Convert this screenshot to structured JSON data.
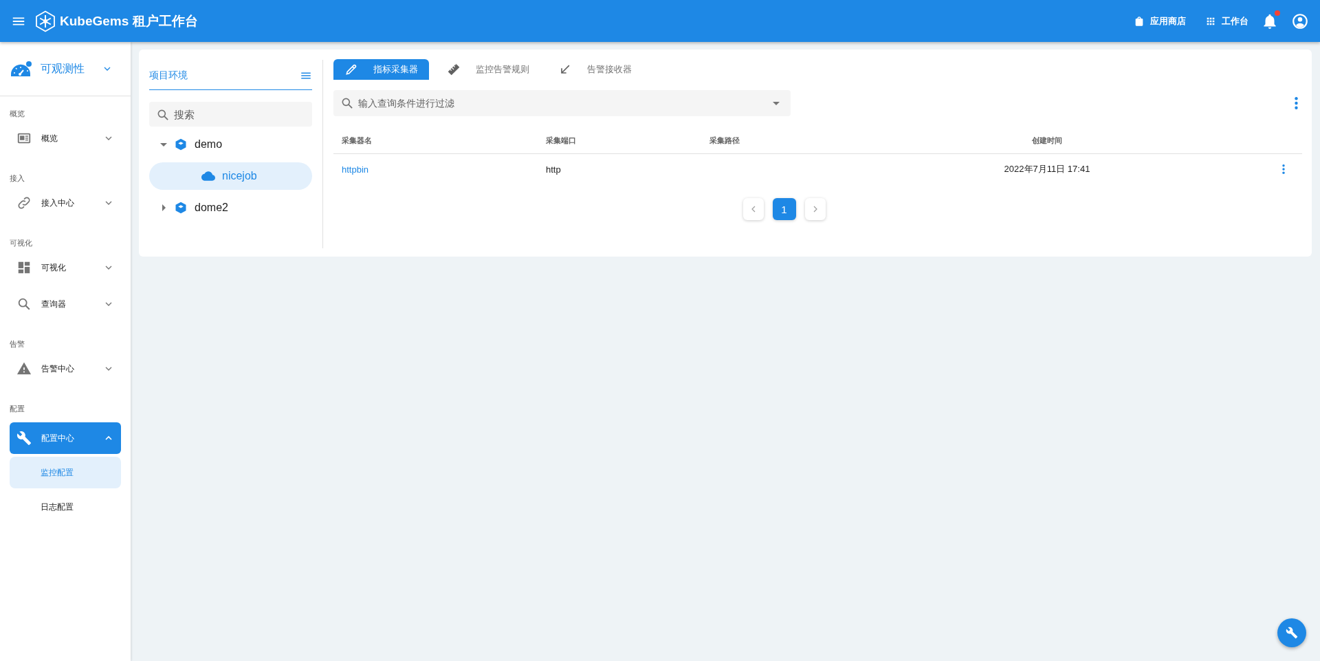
{
  "top_bar": {
    "title": "KubeGems 租户工作台",
    "links": [
      {
        "label": "应用商店",
        "kind": "store"
      },
      {
        "label": "工作台",
        "kind": "apps"
      }
    ],
    "notifications": {
      "unread": true
    }
  },
  "sidebar": {
    "header": {
      "label": "可观测性",
      "expanded": false
    },
    "sections": [
      {
        "label": "概览",
        "items": [
          {
            "label": "概览",
            "kind": "overview",
            "selected": false,
            "expanded": false
          }
        ]
      },
      {
        "label": "接入",
        "items": [
          {
            "label": "接入中心",
            "kind": "link",
            "selected": false,
            "expanded": false
          }
        ]
      },
      {
        "label": "可视化",
        "items": [
          {
            "label": "可视化",
            "kind": "dashboard",
            "selected": false,
            "expanded": false
          },
          {
            "label": "查询器",
            "kind": "search",
            "selected": false,
            "expanded": false
          }
        ]
      },
      {
        "label": "告警",
        "items": [
          {
            "label": "告警中心",
            "kind": "warning",
            "selected": false,
            "expanded": false
          }
        ]
      },
      {
        "label": "配置",
        "items": [
          {
            "label": "配置中心",
            "kind": "wrench",
            "selected": true,
            "expanded": true,
            "children": [
              {
                "label": "监控配置",
                "selected": true
              },
              {
                "label": "日志配置",
                "selected": false
              }
            ]
          }
        ]
      }
    ]
  },
  "tree_panel": {
    "title": "项目环境",
    "search": {
      "placeholder": "搜索"
    },
    "items": [
      {
        "label": "demo",
        "kind": "project",
        "expanded": true,
        "selected": false,
        "children": [
          {
            "label": "nicejob",
            "kind": "environment",
            "selected": true
          }
        ]
      },
      {
        "label": "dome2",
        "kind": "project",
        "expanded": false,
        "selected": false
      }
    ]
  },
  "tabs": [
    {
      "label": "指标采集器",
      "kind": "collector",
      "selected": true
    },
    {
      "label": "监控告警规则",
      "kind": "rule",
      "selected": false
    },
    {
      "label": "告警接收器",
      "kind": "receiver",
      "selected": false
    }
  ],
  "filter": {
    "placeholder": "输入查询条件进行过滤"
  },
  "table": {
    "columns": [
      "采集器名",
      "采集端口",
      "采集路径",
      "创建时间"
    ],
    "rows": [
      {
        "cells": [
          "httpbin",
          "http",
          "",
          "2022年7月11日 17:41"
        ]
      }
    ]
  },
  "pagination": {
    "pages": [
      {
        "label": "1",
        "selected": true
      }
    ]
  }
}
